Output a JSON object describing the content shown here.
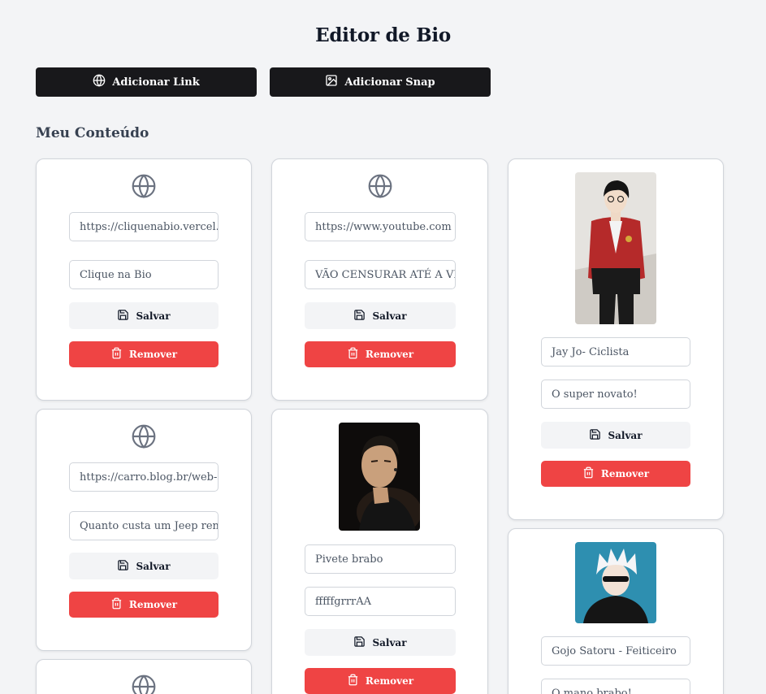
{
  "header": {
    "title": "Editor de Bio"
  },
  "toolbar": {
    "add_link_label": "Adicionar Link",
    "add_snap_label": "Adicionar Snap"
  },
  "section": {
    "title": "Meu Conteúdo"
  },
  "actions": {
    "save_label": "Salvar",
    "remove_label": "Remover"
  },
  "links": [
    {
      "url": "https://cliquenabio.vercel.",
      "title": "Clique na Bio"
    },
    {
      "url": "https://www.youtube.com",
      "title": "VÃO CENSURAR ATÉ A VEI"
    },
    {
      "url": "https://carro.blog.br/web-",
      "title": "Quanto custa um Jeep ren"
    }
  ],
  "snaps": [
    {
      "title": "Jay Jo- Ciclista",
      "description": "O super novato!"
    },
    {
      "title": "Pivete brabo",
      "description": "fffffgrrrAA"
    },
    {
      "title": "Gojo Satoru - Feiticeiro",
      "description": "O mano brabo!"
    }
  ],
  "colors": {
    "primary": "#18181b",
    "danger": "#ef4444",
    "background": "#f3f4f6"
  }
}
